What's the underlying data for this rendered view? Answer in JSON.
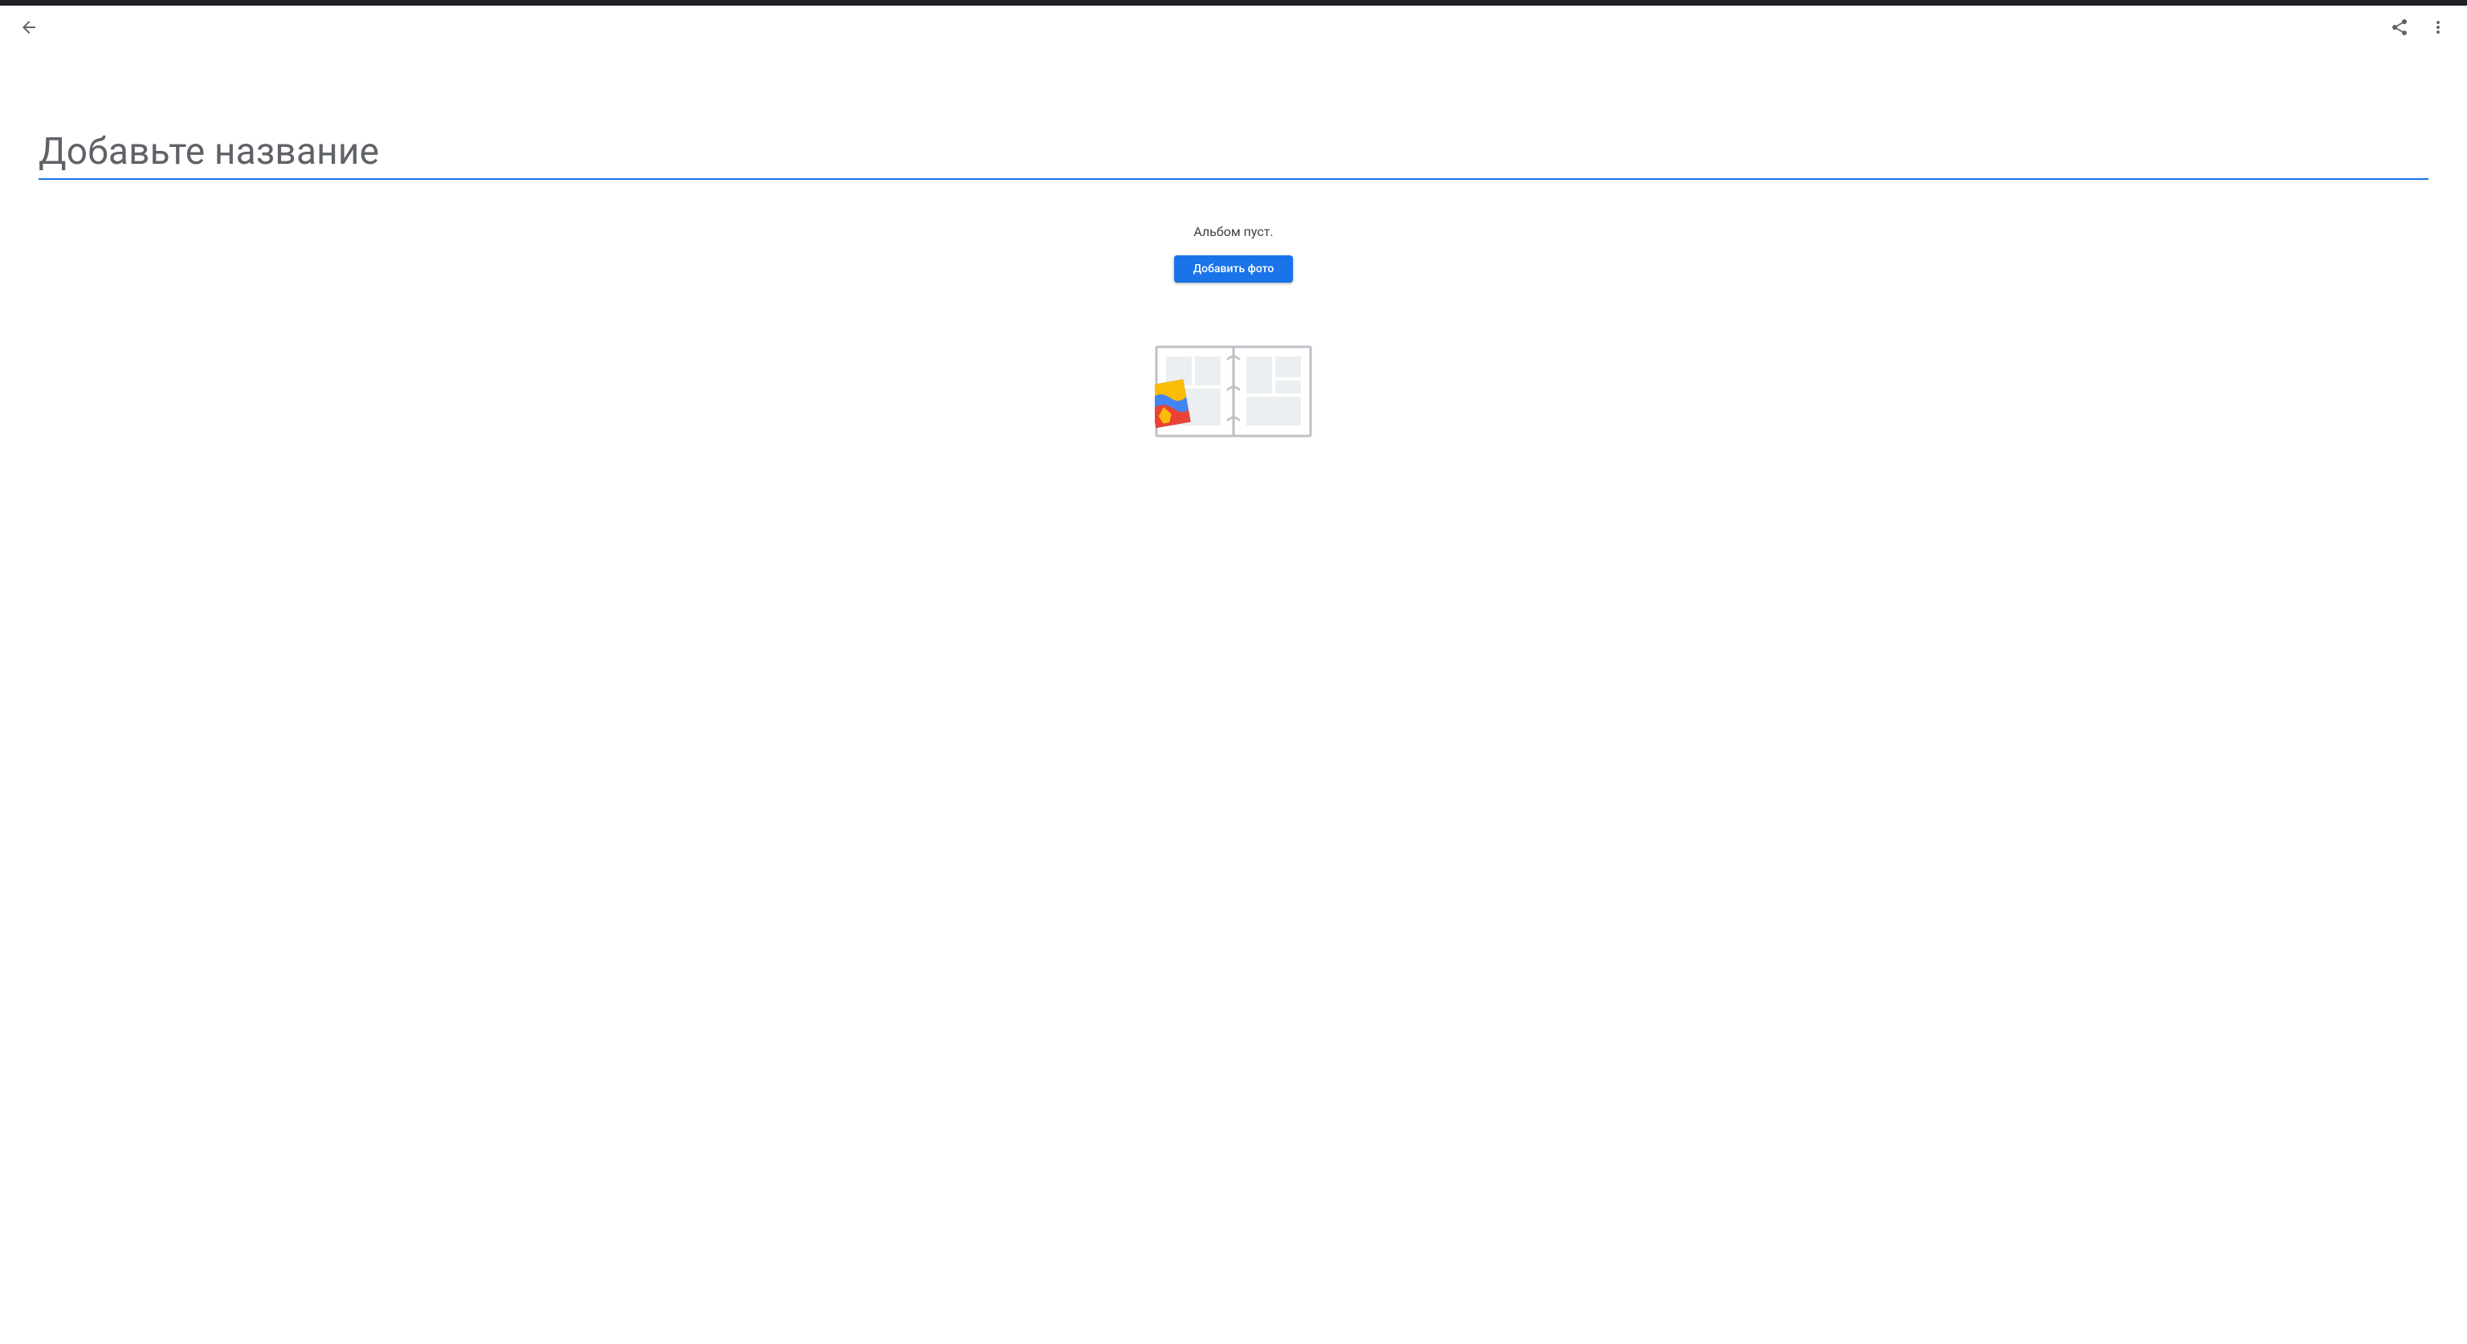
{
  "title_input": {
    "placeholder": "Добавьте название",
    "value": ""
  },
  "empty_state": {
    "message": "Альбом пуст.",
    "button_label": "Добавить фото"
  }
}
